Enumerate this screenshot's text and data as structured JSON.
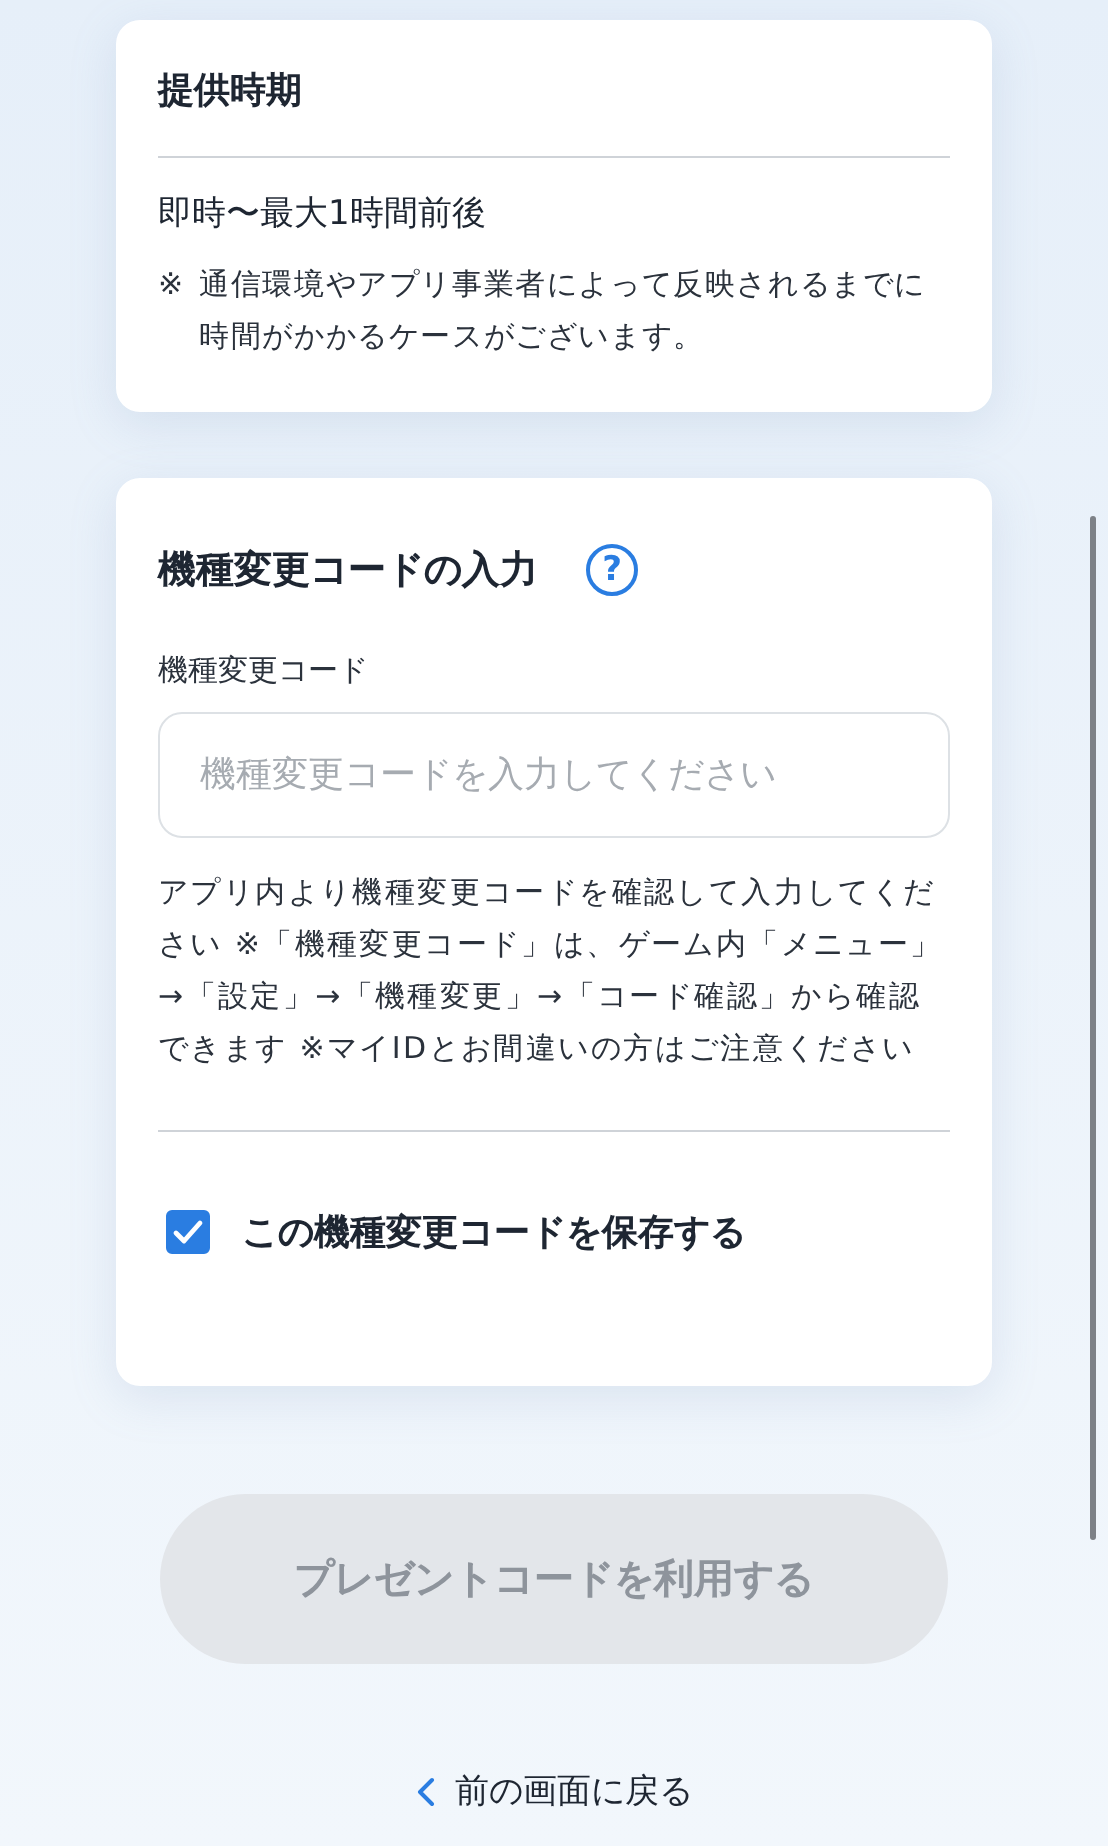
{
  "delivery_card": {
    "title": "提供時期",
    "timing": "即時〜最大1時間前後",
    "note_mark": "※",
    "note": "通信環境やアプリ事業者によって反映されるまでに時間がかかるケースがございます。"
  },
  "code_card": {
    "title": "機種変更コードの入力",
    "help_icon": "?",
    "field_label": "機種変更コード",
    "field": {
      "placeholder": "機種変更コードを入力してください"
    },
    "helper_text": "アプリ内より機種変更コードを確認して入力してください ※「機種変更コード」は、ゲーム内「メニュー」→「設定」→「機種変更」→「コード確認」から確認できます ※マイIDとお間違いの方はご注意ください",
    "save_checkbox": {
      "label": "この機種変更コードを保存する",
      "checked": true
    }
  },
  "submit_button": {
    "label": "プレゼントコードを利用する",
    "disabled": true
  },
  "back_link": {
    "label": "前の画面に戻る"
  }
}
